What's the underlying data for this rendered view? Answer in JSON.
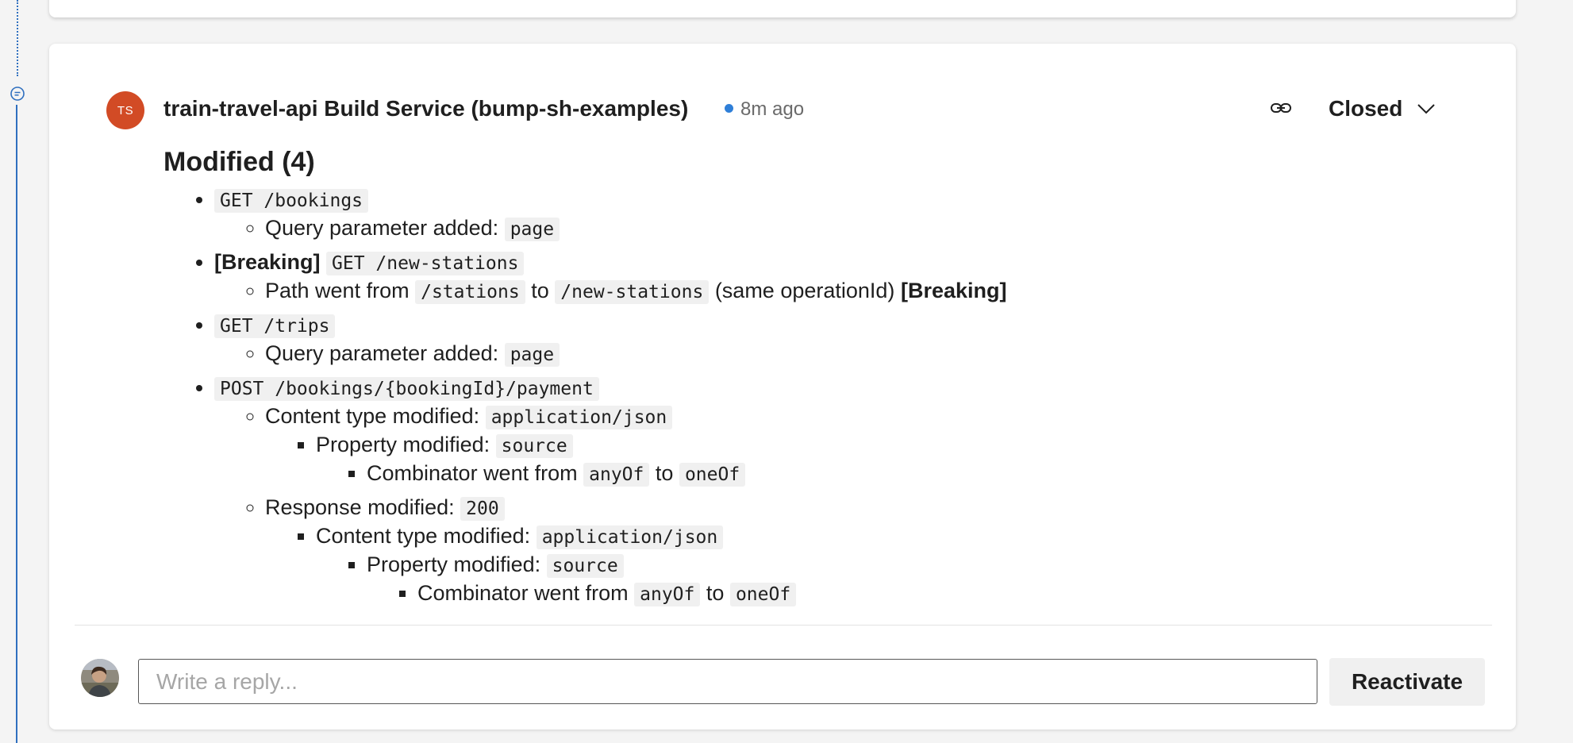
{
  "thread": {
    "author_initials": "TS",
    "author": "train-travel-api Build Service (bump-sh-examples)",
    "time": "8m ago",
    "status": "Closed",
    "heading": "Modified (4)"
  },
  "changes": {
    "c1": {
      "endpoint": "GET /bookings",
      "d1_label": "Query parameter added:",
      "d1_code": "page"
    },
    "c2": {
      "tag": "[Breaking]",
      "endpoint": "GET /new-stations",
      "d1_a": "Path went from",
      "d1_code1": "/stations",
      "d1_b": "to",
      "d1_code2": "/new-stations",
      "d1_c": "(same operationId)",
      "d1_tag": "[Breaking]"
    },
    "c3": {
      "endpoint": "GET /trips",
      "d1_label": "Query parameter added:",
      "d1_code": "page"
    },
    "c4": {
      "endpoint": "POST /bookings/{bookingId}/payment",
      "content_label": "Content type modified:",
      "content_code": "application/json",
      "prop_label": "Property modified:",
      "prop_code": "source",
      "comb_a": "Combinator went from",
      "comb_code1": "anyOf",
      "comb_b": "to",
      "comb_code2": "oneOf",
      "resp_label": "Response modified:",
      "resp_code": "200",
      "r_content_label": "Content type modified:",
      "r_content_code": "application/json",
      "r_prop_label": "Property modified:",
      "r_prop_code": "source",
      "r_comb_a": "Combinator went from",
      "r_comb_code1": "anyOf",
      "r_comb_b": "to",
      "r_comb_code2": "oneOf"
    }
  },
  "reply": {
    "placeholder": "Write a reply...",
    "button": "Reactivate"
  },
  "colors": {
    "accent": "#2f6fbf",
    "avatar": "#d24b25",
    "time_dot": "#2f7fd8"
  },
  "icons": [
    "comment-icon",
    "link-icon",
    "chevron-down-icon"
  ]
}
